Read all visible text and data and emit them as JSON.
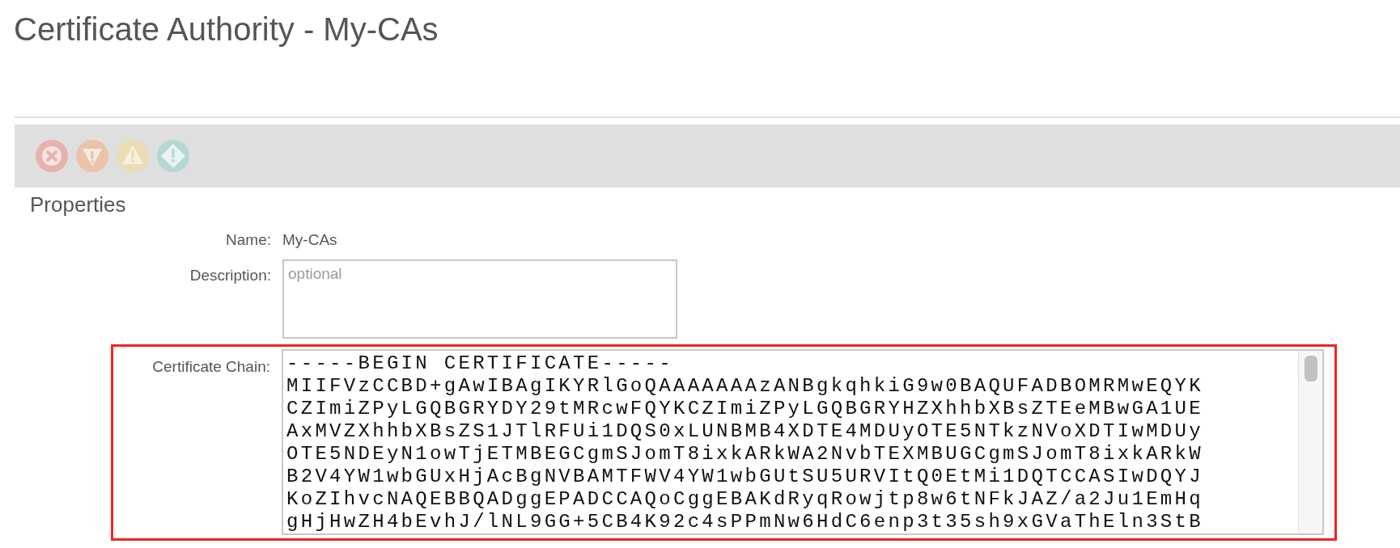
{
  "title": "Certificate Authority - My-CAs",
  "section": "Properties",
  "fields": [
    {
      "kind": "text",
      "label": "Name:",
      "value": "My-CAs",
      "highlighted": false
    },
    {
      "kind": "textarea",
      "label": "Description:",
      "placeholder": "optional",
      "highlighted": false
    },
    {
      "kind": "code",
      "label": "Certificate Chain:",
      "highlighted": true,
      "lines": [
        "-----BEGIN CERTIFICATE-----",
        "MIIFVzCCBD+gAwIBAgIKYRlGoQAAAAAAAzANBgkqhkiG9w0BAQUFADBOMRMwEQYK",
        "CZImiZPyLGQBGRYDY29tMRcwFQYKCZImiZPyLGQBGRYHZXhhbXBsZTEeMBwGA1UE",
        "AxMVZXhhbXBsZS1JTlRFUi1DQS0xLUNBMB4XDTE4MDUyOTE5NTkzNVoXDTIwMDUy",
        "OTE5NDEyN1owTjETMBEGCgmSJomT8ixkARkWA2NvbTEXMBUGCgmSJomT8ixkARkW",
        "B2V4YW1wbGUxHjAcBgNVBAMTFWV4YW1wbGUtSU5URVItQ0EtMi1DQTCCASIwDQYJ",
        "KoZIhvcNAQEBBQADggEPADCCAQoCggEBAKdRyqRowjtp8w6tNFkJAZ/a2Ju1EmHq",
        "gHjHwZH4bEvhJ/lNL9GG+5CB4K92c4sPPmNw6HdC6enp3t35sh9xGVaThEln3StB"
      ]
    }
  ]
}
